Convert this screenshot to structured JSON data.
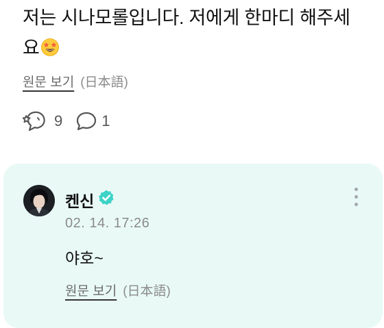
{
  "post": {
    "text": "저는 시나모롤입니다. 저에게 한마디 해주세요",
    "emoji_icon": "star-struck-emoji-icon",
    "original_link": "원문 보기",
    "original_lang": "(日本語)",
    "like_count": "9",
    "comment_count": "1"
  },
  "reply": {
    "username": "켄신",
    "verified_icon": "verified-badge-icon",
    "timestamp": "02. 14. 17:26",
    "text": "야호~",
    "original_link": "원문 보기",
    "original_lang": "(日本語)"
  },
  "colors": {
    "card_background": "#e9faf6",
    "verified": "#3fd2c7",
    "icon_gray": "#555555",
    "muted_text": "#8a8a8a"
  }
}
